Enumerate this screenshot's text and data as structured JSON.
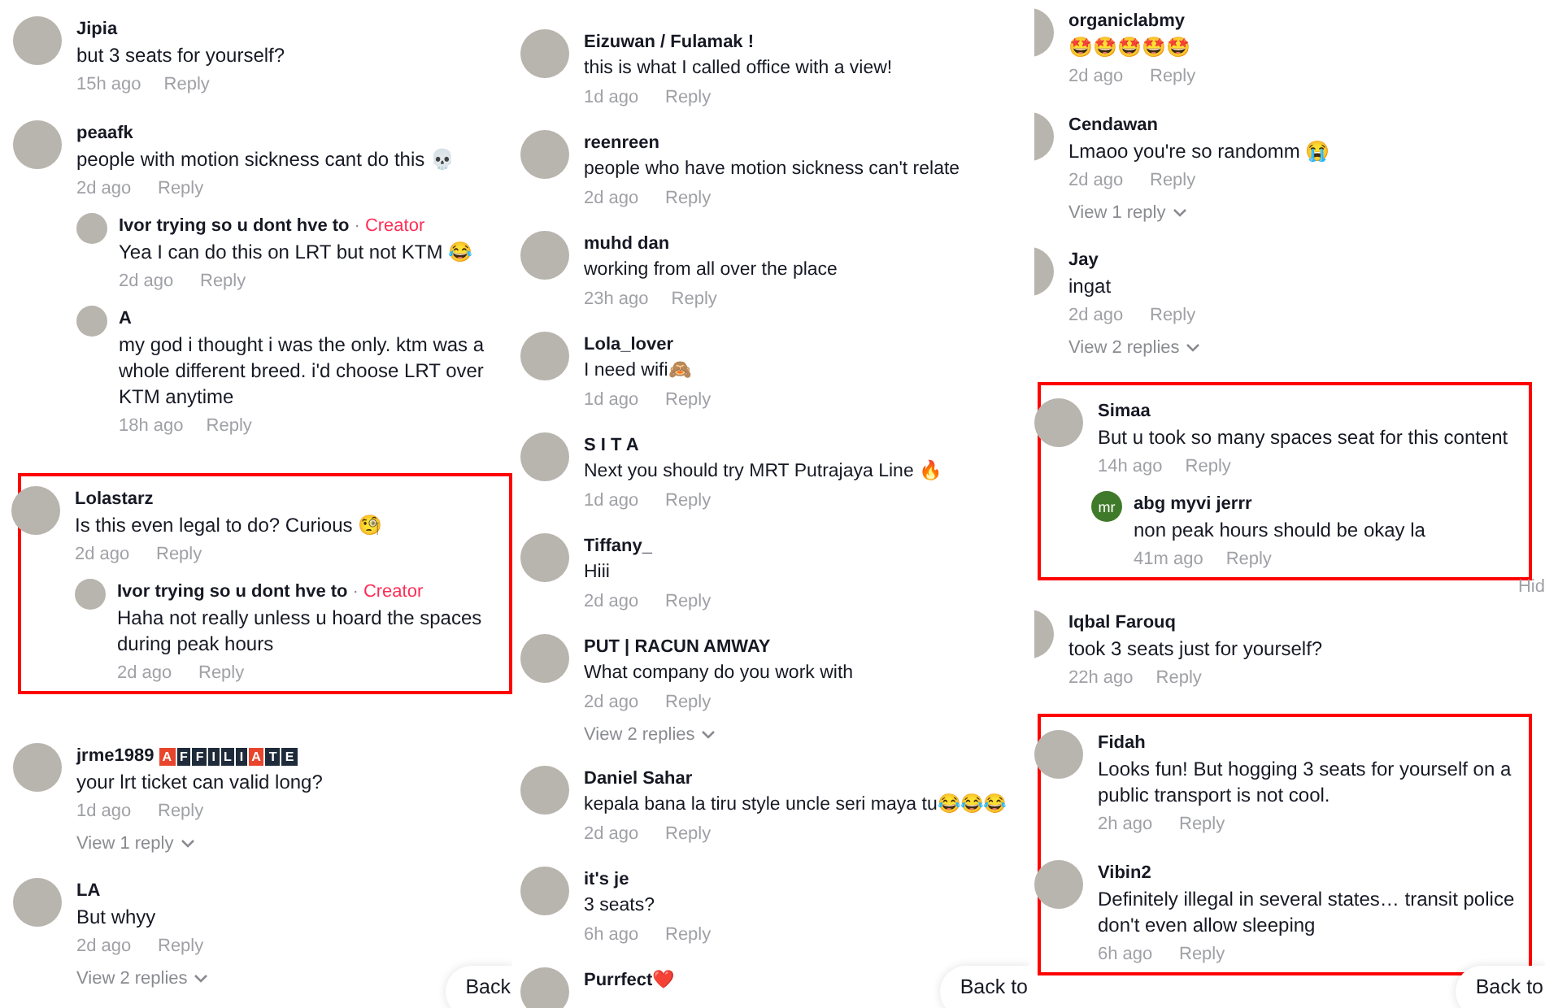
{
  "panels": [
    {
      "groups": [
        {
          "highlighted": false,
          "comments": [
            {
              "name": "Jipia",
              "text": "but 3 seats for yourself?",
              "time": "15h ago",
              "reply": "Reply"
            },
            {
              "name": "peaafk",
              "text": "people with motion sickness cant do this 💀",
              "time": "2d ago",
              "reply": "Reply",
              "replies": [
                {
                  "name": "Ivor trying so u dont hve to",
                  "tag_separator": "·",
                  "tag": "Creator",
                  "text": "Yea I can do this on LRT but not KTM 😂",
                  "time": "2d ago",
                  "reply": "Reply"
                },
                {
                  "name": "A",
                  "text": "my god i thought i was the only. ktm was a whole different breed. i'd choose LRT over KTM anytime",
                  "time": "18h ago",
                  "reply": "Reply"
                }
              ]
            }
          ]
        },
        {
          "highlighted": true,
          "comments": [
            {
              "name": "Lolastarz",
              "text": "Is this even legal to do? Curious 🧐",
              "time": "2d ago",
              "reply": "Reply",
              "replies": [
                {
                  "name": "Ivor trying so u dont hve to",
                  "tag_separator": "·",
                  "tag": "Creator",
                  "text": "Haha not really unless u hoard the spaces during peak hours",
                  "time": "2d ago",
                  "reply": "Reply"
                }
              ]
            }
          ]
        },
        {
          "highlighted": false,
          "comments": [
            {
              "name": "jrme1989",
              "badge": [
                {
                  "char": "A",
                  "accent": true
                },
                {
                  "char": "F",
                  "accent": false
                },
                {
                  "char": "F",
                  "accent": false
                },
                {
                  "char": "I",
                  "accent": false
                },
                {
                  "char": "L",
                  "accent": false
                },
                {
                  "char": "I",
                  "accent": false
                },
                {
                  "char": "A",
                  "accent": true
                },
                {
                  "char": "T",
                  "accent": false
                },
                {
                  "char": "E",
                  "accent": false
                }
              ],
              "text": "your lrt ticket can valid long?",
              "time": "1d ago",
              "reply": "Reply",
              "view_replies": "View 1 reply"
            },
            {
              "name": "LA",
              "text": "But whyy",
              "time": "2d ago",
              "reply": "Reply",
              "view_replies": "View 2 replies"
            }
          ]
        }
      ],
      "back_button": "Back"
    },
    {
      "groups": [
        {
          "highlighted": false,
          "comments": [
            {
              "name": "Eizuwan / Fulamak !",
              "text": "this is what I called office with a view!",
              "time": "1d ago",
              "reply": "Reply"
            },
            {
              "name": "reenreen",
              "text": "people who have motion sickness can't relate",
              "time": "2d ago",
              "reply": "Reply"
            },
            {
              "name": "muhd dan",
              "text": "working from all over the place",
              "time": "23h ago",
              "reply": "Reply"
            },
            {
              "name": "Lola_lover",
              "text": "I need wifi🙈",
              "time": "1d ago",
              "reply": "Reply"
            },
            {
              "name": "S I T A",
              "text": "Next you should try MRT Putrajaya Line 🔥",
              "time": "1d ago",
              "reply": "Reply"
            },
            {
              "name": "Tiffany_",
              "text": "Hiii",
              "time": "2d ago",
              "reply": "Reply"
            },
            {
              "name": "PUT | RACUN AMWAY",
              "text": "What company do you work with",
              "time": "2d ago",
              "reply": "Reply",
              "view_replies": "View 2 replies"
            },
            {
              "name": "Daniel Sahar",
              "text": "kepala bana la tiru style uncle seri maya tu😂😂😂",
              "time": "2d ago",
              "reply": "Reply"
            },
            {
              "name": "it's je",
              "text": "3 seats?",
              "time": "6h ago",
              "reply": "Reply"
            },
            {
              "name": "Purrfect❤️"
            }
          ]
        }
      ],
      "back_button": "Back to"
    },
    {
      "groups": [
        {
          "highlighted": false,
          "comments": [
            {
              "name": "organiclabmy",
              "text": "🤩🤩🤩🤩🤩",
              "time": "2d ago",
              "reply": "Reply"
            },
            {
              "name": "Cendawan",
              "text": "Lmaoo you're so randomm 😭",
              "time": "2d ago",
              "reply": "Reply",
              "view_replies": "View 1 reply"
            },
            {
              "name": "Jay",
              "text": "ingat",
              "time": "2d ago",
              "reply": "Reply",
              "view_replies": "View 2 replies"
            }
          ]
        },
        {
          "highlighted": true,
          "comments": [
            {
              "name": "Simaa",
              "text": "But u took so many spaces seat for this content",
              "time": "14h ago",
              "reply": "Reply",
              "replies": [
                {
                  "name": "abg myvi jerrr",
                  "text": "non peak hours should be okay la",
                  "time": "41m ago",
                  "reply": "Reply",
                  "avatar_text": "mr"
                }
              ]
            }
          ]
        },
        {
          "highlighted": false,
          "hide_link": "Hid",
          "comments": [
            {
              "name": "Iqbal Farouq",
              "text": "took 3 seats just for yourself?",
              "time": "22h ago",
              "reply": "Reply"
            }
          ]
        },
        {
          "highlighted": true,
          "comments": [
            {
              "name": "Fidah",
              "text": "Looks fun! But hogging 3 seats for yourself on a public transport is not cool.",
              "time": "2h ago",
              "reply": "Reply"
            },
            {
              "name": "Vibin2",
              "text": "Definitely illegal in several states… transit police don't even allow sleeping",
              "time": "6h ago",
              "reply": "Reply"
            }
          ]
        }
      ],
      "back_button": "Back to"
    }
  ]
}
